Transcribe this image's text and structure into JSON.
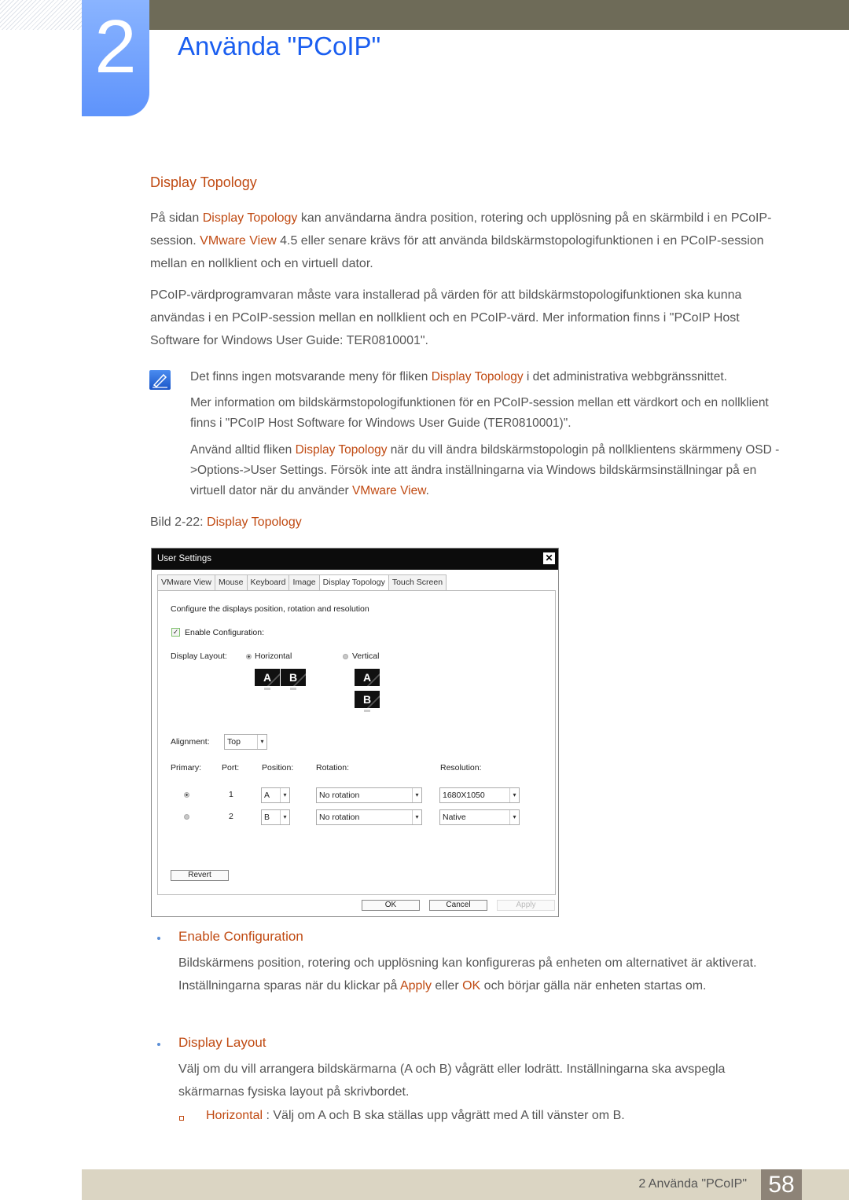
{
  "chapter": {
    "number": "2",
    "title": "Använda \"PCoIP\""
  },
  "section": {
    "title": "Display Topology"
  },
  "paragraphs": {
    "p1": {
      "a": "På sidan ",
      "b": "Display Topology",
      "c": " kan användarna ändra position, rotering och upplösning på en skärmbild i en PCoIP-session. ",
      "d": "VMware View",
      "e": " 4.5 eller senare krävs för att använda bildskärmstopologifunktionen i en PCoIP-session mellan en nollklient och en virtuell dator."
    },
    "p2": "PCoIP-värdprogramvaran måste vara installerad på värden för att bildskärmstopologifunktionen ska kunna användas i en PCoIP-session mellan en nollklient och en PCoIP-värd. Mer information finns i \"PCoIP Host Software for Windows User Guide: TER0810001\"."
  },
  "notes": {
    "n1": {
      "a": "Det finns ingen motsvarande meny för fliken ",
      "b": "Display Topology",
      "c": " i det administrativa webbgränssnittet."
    },
    "n2": "Mer information om bildskärmstopologifunktionen för en PCoIP-session mellan ett värdkort och en nollklient finns i \"PCoIP Host Software for Windows User Guide (TER0810001)\".",
    "n3": {
      "a": "Använd alltid fliken ",
      "b": "Display Topology",
      "c": " när du vill ändra bildskärmstopologin på nollklientens skärmmeny OSD ->Options->User Settings. Försök inte att ändra inställningarna via Windows bildskärmsinställningar på en virtuell dator när du använder ",
      "d": "VMware View",
      "e": "."
    }
  },
  "caption": {
    "prefix": "Bild 2-22: ",
    "title": "Display Topology"
  },
  "dialog": {
    "title": "User Settings",
    "close": "✕",
    "tabs": [
      "VMware View",
      "Mouse",
      "Keyboard",
      "Image",
      "Display Topology",
      "Touch Screen"
    ],
    "active_tab": "Display Topology",
    "description": "Configure the displays position, rotation and resolution",
    "enable_label": "Enable Configuration:",
    "enable_checked": true,
    "layout_label": "Display Layout:",
    "layout_horizontal": "Horizontal",
    "layout_vertical": "Vertical",
    "layout_selected": "Horizontal",
    "monitor_a": "A",
    "monitor_b": "B",
    "alignment_label": "Alignment:",
    "alignment_value": "Top",
    "headers": {
      "primary": "Primary:",
      "port": "Port:",
      "position": "Position:",
      "rotation": "Rotation:",
      "resolution": "Resolution:"
    },
    "rows": [
      {
        "primary": true,
        "port": "1",
        "position": "A",
        "rotation": "No rotation",
        "resolution": "1680X1050"
      },
      {
        "primary": false,
        "port": "2",
        "position": "B",
        "rotation": "No rotation",
        "resolution": "Native"
      }
    ],
    "revert": "Revert",
    "ok": "OK",
    "cancel": "Cancel",
    "apply": "Apply"
  },
  "bullets": {
    "enable": {
      "title": "Enable Configuration",
      "a": "Bildskärmens position, rotering och upplösning kan konfigureras på enheten om alternativet är aktiverat. Inställningarna sparas när du klickar på ",
      "b": "Apply",
      "c": " eller ",
      "d": "OK",
      "e": " och börjar gälla när enheten startas om."
    },
    "layout": {
      "title": "Display Layout",
      "text": "Välj om du vill arrangera bildskärmarna (A och B) vågrätt eller lodrätt. Inställningarna ska avspegla skärmarnas fysiska layout på skrivbordet.",
      "sub": {
        "title": "Horizontal",
        "text": " : Välj om A och B ska ställas upp vågrätt med A till vänster om B."
      }
    }
  },
  "footer": {
    "text": "2 Använda \"PCoIP\"",
    "page": "58"
  }
}
